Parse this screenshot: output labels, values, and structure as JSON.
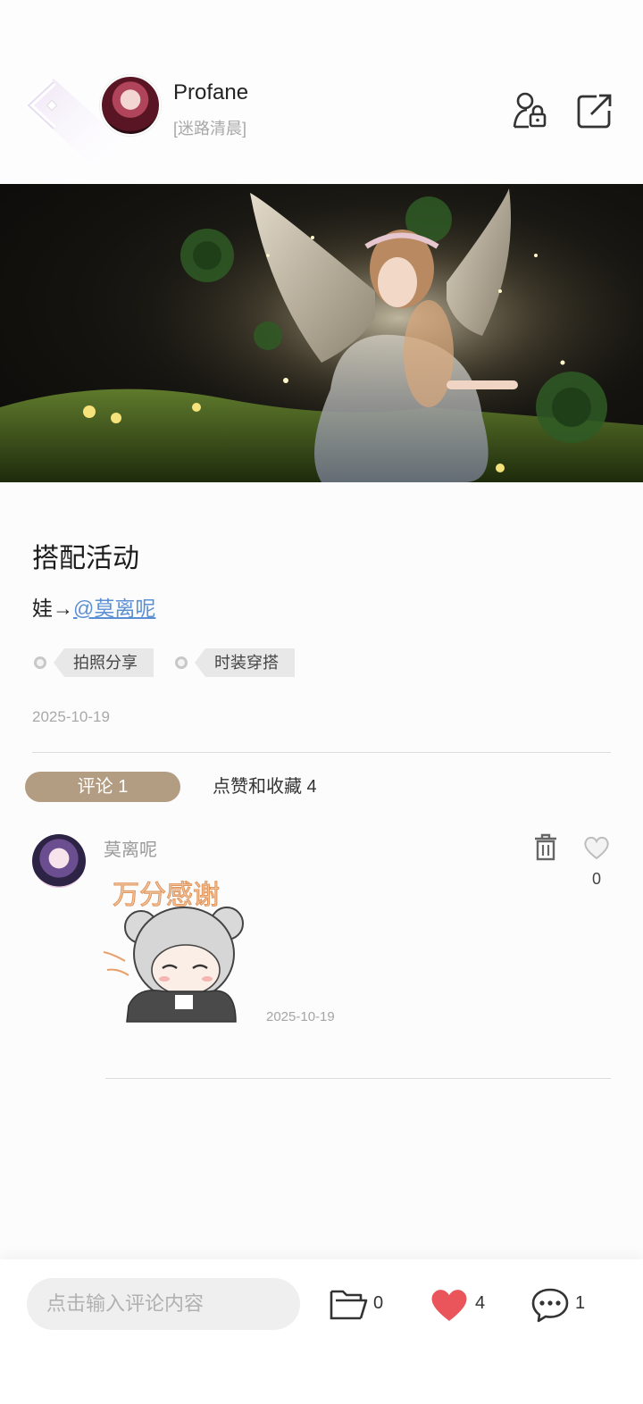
{
  "header": {
    "username": "Profane",
    "subtitle": "[迷路清晨]"
  },
  "post": {
    "title": "搭配活动",
    "body_prefix": "娃→",
    "mention": "@莫离呢",
    "tags": [
      "拍照分享",
      "时装穿搭"
    ],
    "date": "2025-10-19"
  },
  "tabs": {
    "comments": "评论 1",
    "likes": "点赞和收藏 4"
  },
  "comment": {
    "author": "莫离呢",
    "sticker_text": "万分感谢",
    "date": "2025-10-19",
    "likes": "0"
  },
  "bottom_bar": {
    "input_placeholder": "点击输入评论内容",
    "favorites": "0",
    "likes": "4",
    "comments": "1"
  },
  "colors": {
    "accent_tab": "#b39d82",
    "mention": "#5b8fd3",
    "like_heart": "#e9555b"
  }
}
